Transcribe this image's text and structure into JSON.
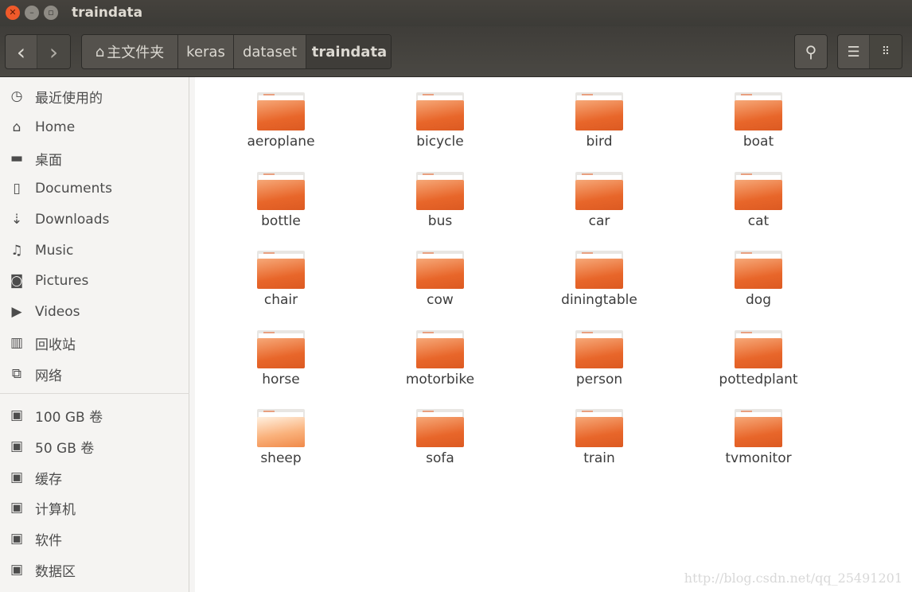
{
  "window": {
    "title": "traindata",
    "close_icon": "close-icon",
    "minimize_icon": "minimize-icon",
    "maximize_icon": "maximize-icon"
  },
  "toolbar": {
    "back": "‹",
    "forward": "›",
    "breadcrumbs": [
      {
        "label": "主文件夹",
        "icon": "home-icon"
      },
      {
        "label": "keras"
      },
      {
        "label": "dataset"
      },
      {
        "label": "traindata",
        "active": true
      }
    ],
    "search_icon": "search-icon",
    "list_view_icon": "list-view-icon",
    "grid_view_icon": "grid-view-icon"
  },
  "sidebar": {
    "places": [
      {
        "label": "最近使用的",
        "icon": "clock-icon"
      },
      {
        "label": "Home",
        "icon": "home-icon"
      },
      {
        "label": "桌面",
        "icon": "folder-icon"
      },
      {
        "label": "Documents",
        "icon": "document-icon"
      },
      {
        "label": "Downloads",
        "icon": "download-icon"
      },
      {
        "label": "Music",
        "icon": "music-icon"
      },
      {
        "label": "Pictures",
        "icon": "camera-icon"
      },
      {
        "label": "Videos",
        "icon": "video-icon"
      },
      {
        "label": "回收站",
        "icon": "trash-icon"
      },
      {
        "label": "网络",
        "icon": "network-icon"
      }
    ],
    "devices": [
      {
        "label": "100 GB 卷",
        "icon": "drive-icon"
      },
      {
        "label": "50 GB 卷",
        "icon": "drive-icon"
      },
      {
        "label": "缓存",
        "icon": "disk-icon"
      },
      {
        "label": "计算机",
        "icon": "disk-icon"
      },
      {
        "label": "软件",
        "icon": "disk-icon"
      },
      {
        "label": "数据区",
        "icon": "disk-icon"
      }
    ]
  },
  "files": [
    "aeroplane",
    "bicycle",
    "bird",
    "boat",
    "bottle",
    "bus",
    "car",
    "cat",
    "chair",
    "cow",
    "diningtable",
    "dog",
    "horse",
    "motorbike",
    "person",
    "pottedplant",
    "sheep",
    "sofa",
    "train",
    "tvmonitor"
  ],
  "hovered_file": "sheep",
  "colors": {
    "accent": "#e8662a",
    "close": "#f05a2a"
  },
  "watermark": "http://blog.csdn.net/qq_25491201"
}
